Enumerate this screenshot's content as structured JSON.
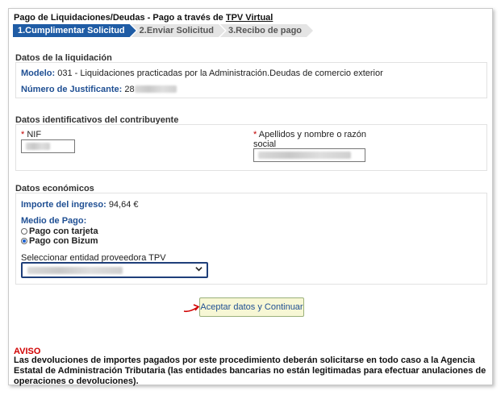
{
  "header": {
    "title_prefix": "Pago de Liquidaciones/Deudas - Pago a través de ",
    "title_link": "TPV Virtual"
  },
  "steps": [
    {
      "label": "1.Cumplimentar Solicitud",
      "active": true
    },
    {
      "label": "2.Enviar Solicitud",
      "active": false
    },
    {
      "label": "3.Recibo de pago",
      "active": false
    }
  ],
  "liquidacion": {
    "section_title": "Datos de la liquidación",
    "modelo_label": "Modelo:",
    "modelo_value": "031 - Liquidaciones practicadas por la Administración.Deudas de comercio exterior",
    "justificante_label": "Número de Justificante:",
    "justificante_value": "28"
  },
  "contribuyente": {
    "section_title": "Datos identificativos del contribuyente",
    "required_mark": "*",
    "nif_label": "NIF",
    "apellidos_label_line1": "Apellidos y nombre o razón",
    "apellidos_label_line2": "social"
  },
  "economicos": {
    "section_title": "Datos económicos",
    "importe_label": "Importe del ingreso:",
    "importe_value": "94,64 €",
    "medio_label": "Medio de Pago:",
    "options": [
      {
        "label": "Pago con tarjeta",
        "selected": false
      },
      {
        "label": "Pago con Bizum",
        "selected": true
      }
    ],
    "entidad_label": "Seleccionar entidad proveedora TPV"
  },
  "actions": {
    "submit_label": "Aceptar datos y Continuar"
  },
  "aviso": {
    "title": "AVISO",
    "text": "Las devoluciones de importes pagados por este procedimiento deberán solicitarse en todo caso a la Agencia Estatal de Administración Tributaria (las entidades bancarias no están legitimadas para efectuar anulaciones de operaciones o devoluciones)."
  },
  "colors": {
    "accent": "#1f5ca5",
    "label_blue": "#1f4f93",
    "warning_red": "#d00000",
    "button_bg": "#f7f7d5"
  }
}
